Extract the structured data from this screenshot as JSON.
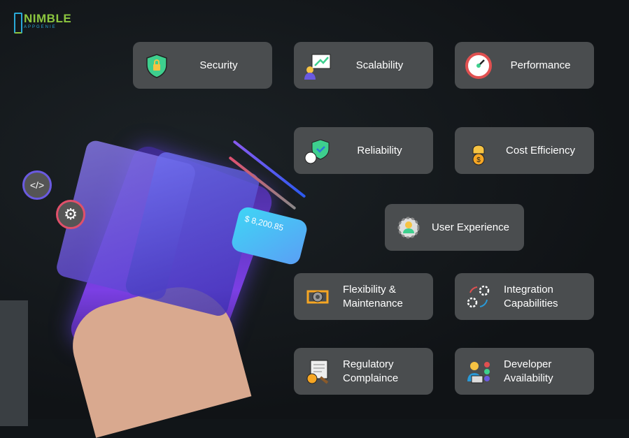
{
  "logo": {
    "name": "NIMBLE",
    "sub": "APPGENIE"
  },
  "illustration": {
    "balance": "$ 8,200.85",
    "code_icon": "</>"
  },
  "cards": [
    {
      "label": "Security",
      "icon": "shield-lock-icon"
    },
    {
      "label": "Scalability",
      "icon": "growth-chart-icon"
    },
    {
      "label": "Performance",
      "icon": "gauge-icon"
    },
    {
      "label": "Reliability",
      "icon": "shield-check-icon"
    },
    {
      "label": "Cost Efficiency",
      "icon": "money-bag-icon"
    },
    {
      "label": "User Experience",
      "icon": "user-circle-icon"
    },
    {
      "label": "Flexibility & Maintenance",
      "icon": "gear-cycle-icon"
    },
    {
      "label": "Integration Capabilities",
      "icon": "gears-icon"
    },
    {
      "label": "Regulatory Complaince",
      "icon": "legal-document-icon"
    },
    {
      "label": "Developer Availability",
      "icon": "developer-icon"
    }
  ],
  "colors": {
    "card": "#4a4d4f",
    "background": "#111518",
    "accent_green": "#8cc63f",
    "accent_blue": "#2aa9d8"
  }
}
